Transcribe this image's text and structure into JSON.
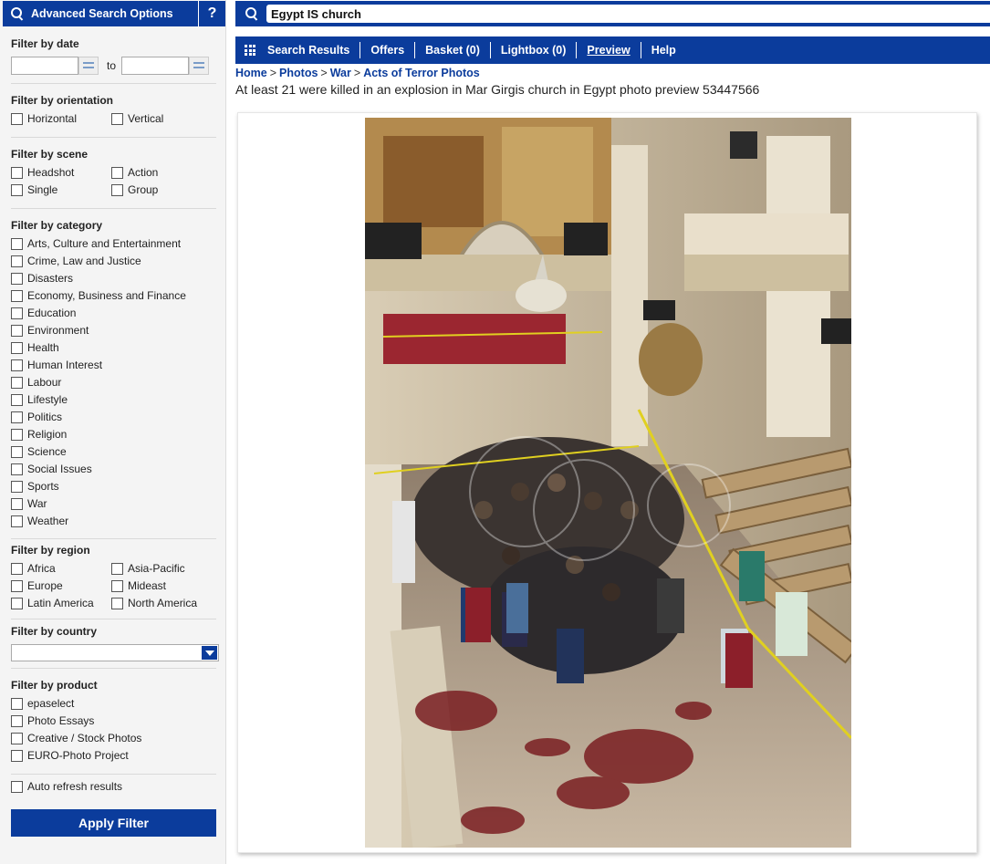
{
  "sidebar": {
    "header_title": "Advanced Search Options",
    "help_label": "?",
    "date": {
      "title": "Filter by date",
      "to_label": "to",
      "from_value": "",
      "to_value": ""
    },
    "orientation": {
      "title": "Filter by orientation",
      "options": [
        "Horizontal",
        "Vertical"
      ]
    },
    "scene": {
      "title": "Filter by scene",
      "options": [
        "Headshot",
        "Action",
        "Single",
        "Group"
      ]
    },
    "category": {
      "title": "Filter by category",
      "options": [
        "Arts, Culture and Entertainment",
        "Crime, Law and Justice",
        "Disasters",
        "Economy, Business and Finance",
        "Education",
        "Environment",
        "Health",
        "Human Interest",
        "Labour",
        "Lifestyle",
        "Politics",
        "Religion",
        "Science",
        "Social Issues",
        "Sports",
        "War",
        "Weather"
      ]
    },
    "region": {
      "title": "Filter by region",
      "options": [
        "Africa",
        "Asia-Pacific",
        "Europe",
        "Mideast",
        "Latin America",
        "North America"
      ]
    },
    "country": {
      "title": "Filter by country",
      "selected": ""
    },
    "product": {
      "title": "Filter by product",
      "options": [
        "epaselect",
        "Photo Essays",
        "Creative / Stock Photos",
        "EURO-Photo Project"
      ]
    },
    "auto_refresh_label": "Auto refresh results",
    "apply_label": "Apply Filter"
  },
  "search": {
    "query": "Egypt IS church"
  },
  "nav": {
    "items": [
      {
        "label": "Search Results",
        "active": false
      },
      {
        "label": "Offers",
        "active": false
      },
      {
        "label": "Basket (0)",
        "active": false
      },
      {
        "label": "Lightbox (0)",
        "active": false
      },
      {
        "label": "Preview",
        "active": true
      },
      {
        "label": "Help",
        "active": false
      }
    ]
  },
  "breadcrumb": {
    "items": [
      "Home",
      "Photos",
      "War",
      "Acts of Terror Photos"
    ],
    "separator": ">"
  },
  "caption": "At least 21 were killed in an explosion in Mar Girgis church in Egypt photo preview 53447566",
  "colors": {
    "brand_blue": "#0b3c9c",
    "sidebar_bg": "#f4f4f4"
  }
}
